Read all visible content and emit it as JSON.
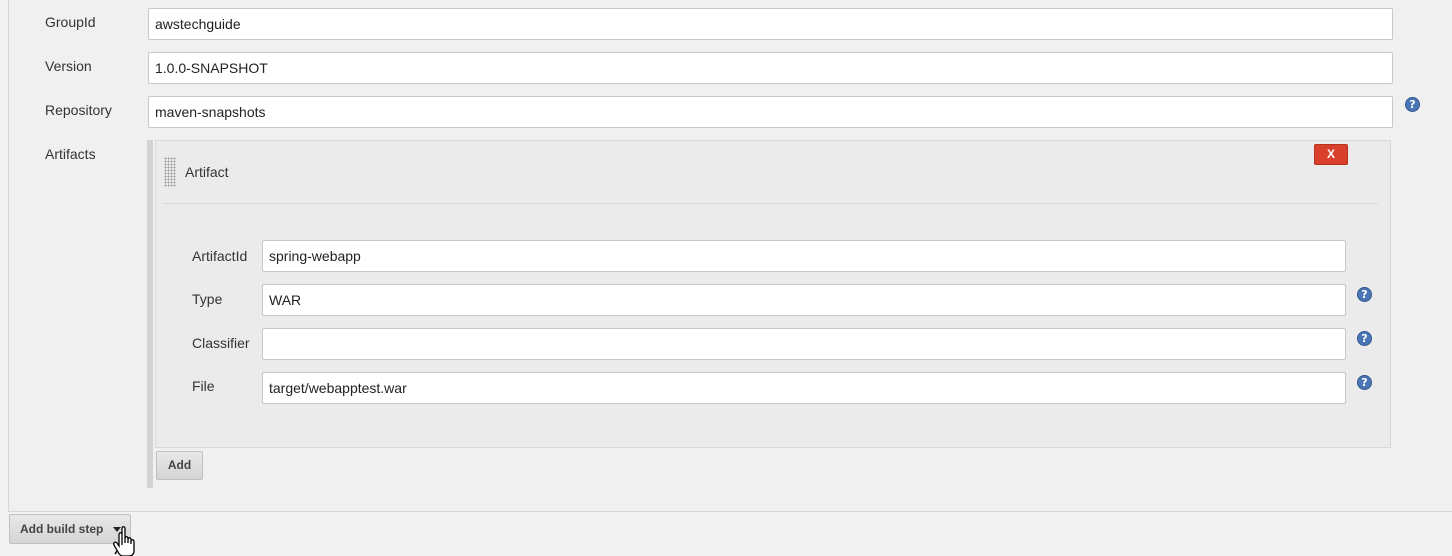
{
  "fields": {
    "group_id": {
      "label": "GroupId",
      "value": "awstechguide"
    },
    "version": {
      "label": "Version",
      "value": "1.0.0-SNAPSHOT"
    },
    "repository": {
      "label": "Repository",
      "value": "maven-snapshots"
    },
    "artifacts_label": "Artifacts"
  },
  "artifact": {
    "header": "Artifact",
    "delete_label": "X",
    "artifact_id": {
      "label": "ArtifactId",
      "value": "spring-webapp"
    },
    "type": {
      "label": "Type",
      "value": "WAR"
    },
    "classifier": {
      "label": "Classifier",
      "value": ""
    },
    "file": {
      "label": "File",
      "value": "target/webapptest.war"
    }
  },
  "buttons": {
    "add": "Add",
    "add_build_step": "Add build step"
  },
  "icons": {
    "help": "help-icon",
    "drag": "drag-handle-icon",
    "caret": "caret-down-icon",
    "cursor": "hand-pointer-cursor"
  },
  "colors": {
    "delete": "#d9402b",
    "help": "#4a76b5"
  }
}
